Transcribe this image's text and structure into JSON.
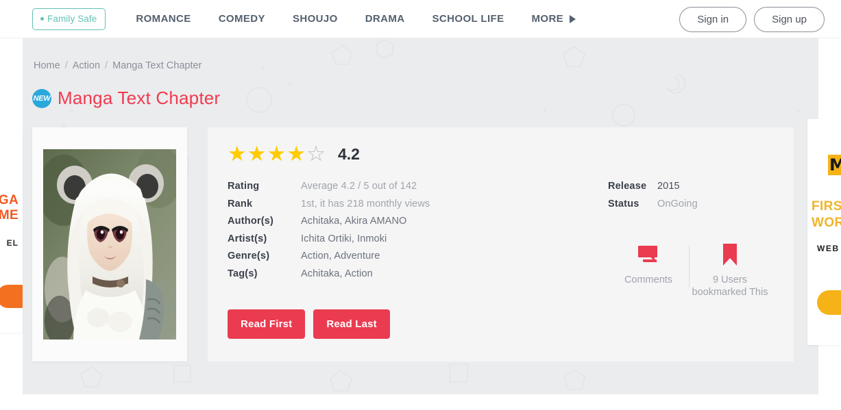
{
  "nav": {
    "family_safe": {
      "label": "Family Safe"
    },
    "items": [
      {
        "label": "ROMANCE"
      },
      {
        "label": "COMEDY"
      },
      {
        "label": "SHOUJO"
      },
      {
        "label": "DRAMA"
      },
      {
        "label": "SCHOOL LIFE"
      }
    ],
    "more_label": "MORE",
    "sign_in": "Sign in",
    "sign_up": "Sign up"
  },
  "breadcrumb": {
    "items": [
      {
        "label": "Home"
      },
      {
        "label": "Action"
      },
      {
        "label": "Manga Text Chapter"
      }
    ],
    "separator": "/"
  },
  "page": {
    "badge": "NEW",
    "title": "Manga Text Chapter"
  },
  "rating": {
    "score": "4.2",
    "filled_stars": 4,
    "total_stars": 5,
    "star_glyph_filled": "★",
    "star_glyph_empty": "☆"
  },
  "details_left": [
    {
      "label": "Rating",
      "value": "Average 4.2 / 5 out of 142"
    },
    {
      "label": "Rank",
      "value": "1st, it has 218 monthly views"
    },
    {
      "label": "Author(s)",
      "value": "Achitaka,  Akira AMANO"
    },
    {
      "label": "Artist(s)",
      "value": "Ichita Ortiki,  Inmoki"
    },
    {
      "label": "Genre(s)",
      "value": "Action,  Adventure"
    },
    {
      "label": "Tag(s)",
      "value": "Achitaka,  Action"
    }
  ],
  "details_right": [
    {
      "label": "Release",
      "value": "2015"
    },
    {
      "label": "Status",
      "value": "OnGoing"
    }
  ],
  "stats": {
    "comments": {
      "icon": "comment-icon",
      "label": "Comments"
    },
    "bookmarks": {
      "icon": "bookmark-icon",
      "label": "9 Users bookmarked This"
    }
  },
  "actions": {
    "read_first": "Read First",
    "read_last": "Read Last"
  },
  "ads": {
    "left": {
      "title_line1": "GA",
      "title_line2": "ME",
      "subtitle": "EL"
    },
    "right": {
      "logo": "M",
      "title_line1": "FIRST",
      "title_line2": "WOR",
      "subtitle": "WEB"
    }
  },
  "colors": {
    "accent_red": "#ea3b50",
    "title_red": "#ef3b4f",
    "teal": "#62c2b4",
    "badge_blue": "#29a8dc",
    "star_yellow": "#ffcc00",
    "page_bg": "#ebecee",
    "card_bg": "#f5f5f6"
  }
}
